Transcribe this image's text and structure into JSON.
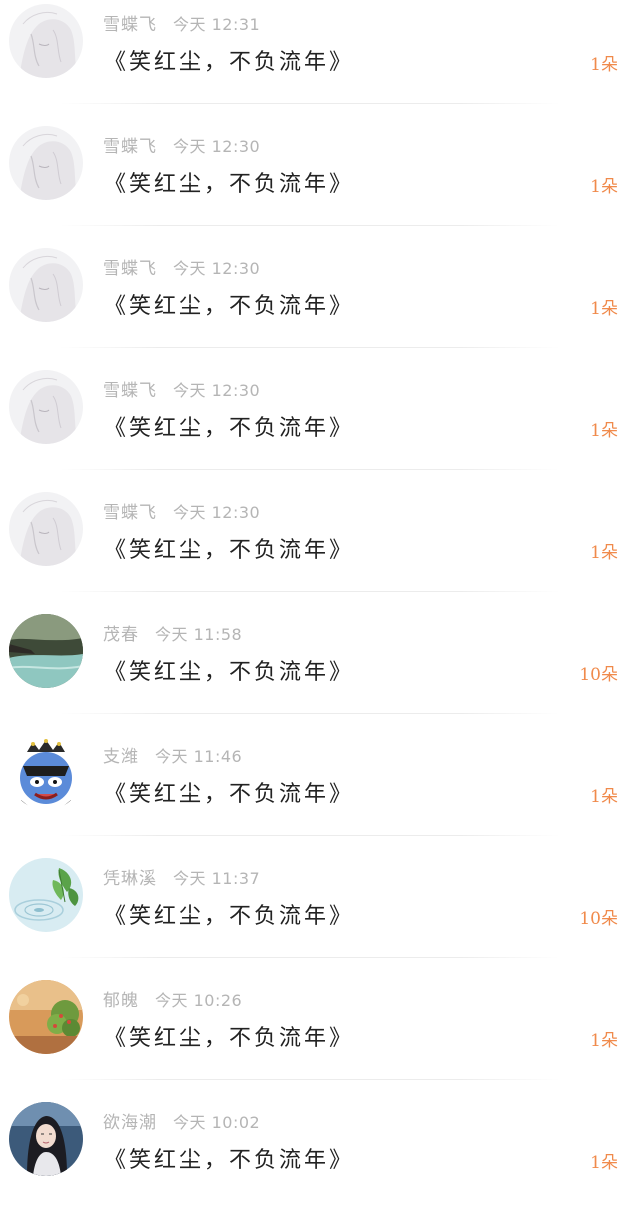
{
  "messages": [
    {
      "user": "雪蝶飞",
      "time": "今天 12:31",
      "title": "《笑红尘，不负流年》",
      "gift": "1朵",
      "avatar": "sketch-portrait-avatar"
    },
    {
      "user": "雪蝶飞",
      "time": "今天 12:30",
      "title": "《笑红尘，不负流年》",
      "gift": "1朵",
      "avatar": "sketch-portrait-avatar"
    },
    {
      "user": "雪蝶飞",
      "time": "今天 12:30",
      "title": "《笑红尘，不负流年》",
      "gift": "1朵",
      "avatar": "sketch-portrait-avatar"
    },
    {
      "user": "雪蝶飞",
      "time": "今天 12:30",
      "title": "《笑红尘，不负流年》",
      "gift": "1朵",
      "avatar": "sketch-portrait-avatar"
    },
    {
      "user": "雪蝶飞",
      "time": "今天 12:30",
      "title": "《笑红尘，不负流年》",
      "gift": "1朵",
      "avatar": "sketch-portrait-avatar"
    },
    {
      "user": "茂春",
      "time": "今天 11:58",
      "title": "《笑红尘，不负流年》",
      "gift": "10朵",
      "avatar": "river-landscape-avatar"
    },
    {
      "user": "支潍",
      "time": "今天 11:46",
      "title": "《笑红尘，不负流年》",
      "gift": "1朵",
      "avatar": "cartoon-character-avatar"
    },
    {
      "user": "凭琳溪",
      "time": "今天 11:37",
      "title": "《笑红尘，不负流年》",
      "gift": "10朵",
      "avatar": "water-leaf-avatar"
    },
    {
      "user": "郁魄",
      "time": "今天 10:26",
      "title": "《笑红尘，不负流年》",
      "gift": "1朵",
      "avatar": "autumn-plant-avatar"
    },
    {
      "user": "欲海潮",
      "time": "今天 10:02",
      "title": "《笑红尘，不负流年》",
      "gift": "1朵",
      "avatar": "girl-portrait-avatar"
    }
  ],
  "colors": {
    "gift": "#f08a4b",
    "meta": "#b5b5b5",
    "title": "#222222"
  }
}
